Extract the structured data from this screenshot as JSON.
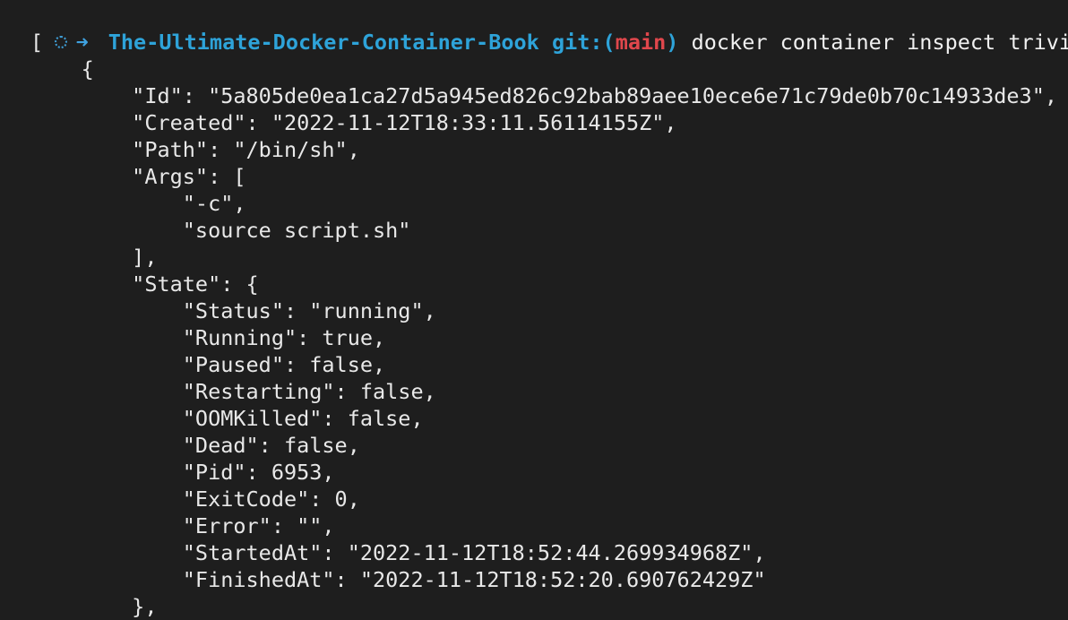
{
  "prompt": {
    "arrow": "➜",
    "directory": "The-Ultimate-Docker-Container-Book",
    "git_prefix": "git:(",
    "branch": "main",
    "git_suffix": ")",
    "command": "docker container inspect trivia"
  },
  "output_lines": [
    "[",
    "    {",
    "        \"Id\": \"5a805de0ea1ca27d5a945ed826c92bab89aee10ece6e71c79de0b70c14933de3\",",
    "        \"Created\": \"2022-11-12T18:33:11.56114155Z\",",
    "        \"Path\": \"/bin/sh\",",
    "        \"Args\": [",
    "            \"-c\",",
    "            \"source script.sh\"",
    "        ],",
    "        \"State\": {",
    "            \"Status\": \"running\",",
    "            \"Running\": true,",
    "            \"Paused\": false,",
    "            \"Restarting\": false,",
    "            \"OOMKilled\": false,",
    "            \"Dead\": false,",
    "            \"Pid\": 6953,",
    "            \"ExitCode\": 0,",
    "            \"Error\": \"\",",
    "            \"StartedAt\": \"2022-11-12T18:52:44.269934968Z\",",
    "            \"FinishedAt\": \"2022-11-12T18:52:20.690762429Z\"",
    "        },"
  ],
  "colors": {
    "background": "#1e1e1e",
    "text": "#e8e8e8",
    "directory": "#2ea3d9",
    "branch": "#e0474c"
  }
}
